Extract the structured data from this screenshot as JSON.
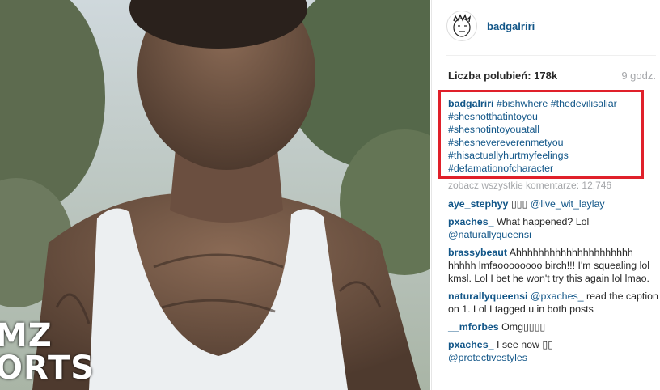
{
  "media": {
    "watermark_line1": "MZ",
    "watermark_line2": "ORTS"
  },
  "header": {
    "username": "badgalriri"
  },
  "stats": {
    "likes": "Liczba polubień: 178k",
    "time": "9 godz."
  },
  "caption": {
    "user": "badgalriri",
    "tags": [
      "#bishwhere",
      "#thedevilisaliar",
      "#shesnotthatintoyou",
      "#shesnotintoyouatall",
      "#shesnevereverenmetyou",
      "#thisactuallyhurtmyfeelings",
      "#defamationofcharacter"
    ]
  },
  "view_all_comments": "zobacz wszystkie komentarze: 12,746",
  "comments": [
    {
      "user": "aye_stephyy",
      "text": "▯▯▯",
      "mention": "@live_wit_laylay"
    },
    {
      "user": "pxaches_",
      "text": "What happened? Lol",
      "mention": "@naturallyqueensi"
    },
    {
      "user": "brassybeaut",
      "text": "Ahhhhhhhhhhhhhhhhhhhhh hhhhh lmfaoooooooo birch!!! I'm squealing lol kmsl. Lol I bet he won't try this again lol lmao.",
      "mention": ""
    },
    {
      "user": "naturallyqueensi",
      "text": "read the caption on 1. Lol I tagged u in both posts",
      "mention": "@pxaches_"
    },
    {
      "user": "__mforbes",
      "text": "Omg▯▯▯▯",
      "mention": ""
    },
    {
      "user": "pxaches_",
      "text": "I see now ▯▯",
      "mention": "@protectivestyles"
    }
  ]
}
